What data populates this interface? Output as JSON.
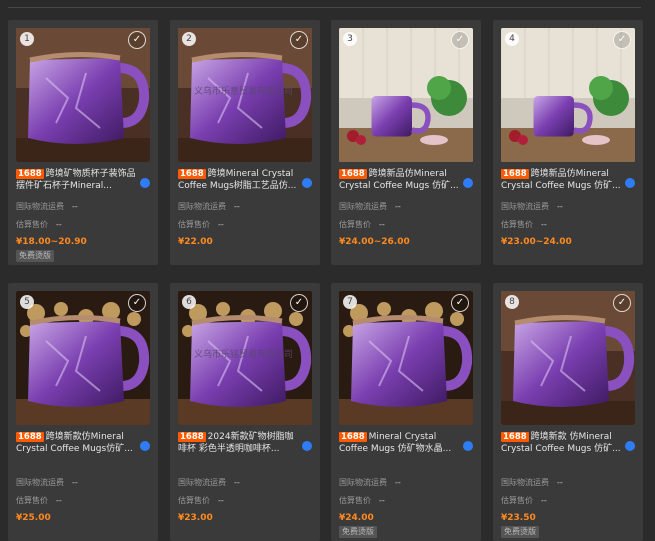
{
  "labels": {
    "shipping_label": "国际物流运费",
    "price_est_label": "估算售价",
    "dash": "--",
    "free_shipping": "免费烫版",
    "badge": "1688"
  },
  "products": [
    {
      "num": "1",
      "title": "跨境矿物质杯子装饰品摆件矿石杯子Mineral...",
      "price": "¥18.00~20.90",
      "free": true,
      "selected": true,
      "scene": "mug"
    },
    {
      "num": "2",
      "title": "跨境Mineral Crystal Coffee Mugs树脂工艺品仿...",
      "price": "¥22.00",
      "free": false,
      "selected": true,
      "scene": "mug",
      "watermark": "义乌市乐意贸易有限公司"
    },
    {
      "num": "3",
      "title": "跨境新品仿Mineral Crystal Coffee Mugs 仿矿...",
      "price": "¥24.00~26.00",
      "free": false,
      "selected": false,
      "scene": "kitchen"
    },
    {
      "num": "4",
      "title": "跨境新品仿Mineral Crystal Coffee Mugs 仿矿...",
      "price": "¥23.00~24.00",
      "free": false,
      "selected": false,
      "scene": "kitchen"
    },
    {
      "num": "5",
      "title": "跨境新款仿Mineral Crystal Coffee Mugs仿矿...",
      "price": "¥25.00",
      "free": false,
      "selected": false,
      "scene": "bokeh"
    },
    {
      "num": "6",
      "title": "2024新款矿物树脂咖啡杯 彩色半透明咖啡杯...",
      "price": "¥23.00",
      "free": false,
      "selected": false,
      "scene": "bokeh",
      "watermark": "义乌市乐铭贸易有限公司"
    },
    {
      "num": "7",
      "title": "Mineral Crystal Coffee Mugs 仿矿物水晶...",
      "price": "¥24.00",
      "free": true,
      "selected": false,
      "scene": "bokeh"
    },
    {
      "num": "8",
      "title": "跨境新款 仿Mineral Crystal Coffee Mugs 仿矿...",
      "price": "¥23.50",
      "free": true,
      "selected": true,
      "scene": "mug"
    }
  ],
  "colors": {
    "badge": "#ff5a00",
    "price": "#ff8a1f",
    "accent_blue": "#2f7df6",
    "card": "#3a3a3a"
  }
}
